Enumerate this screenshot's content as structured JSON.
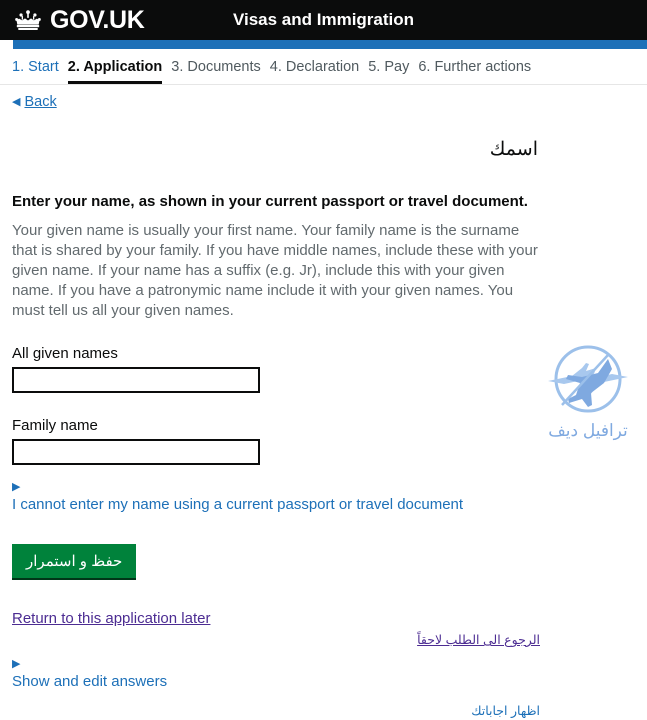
{
  "header": {
    "crown_icon": "crown-icon",
    "brand": "GOV.UK",
    "service_name": "Visas and Immigration"
  },
  "step_nav": {
    "steps": [
      {
        "label": "1. Start",
        "state": "link"
      },
      {
        "label": "2. Application",
        "state": "current"
      },
      {
        "label": "3. Documents",
        "state": "inactive"
      },
      {
        "label": "4. Declaration",
        "state": "inactive"
      },
      {
        "label": "5. Pay",
        "state": "inactive"
      },
      {
        "label": "6. Further actions",
        "state": "inactive"
      }
    ]
  },
  "back": {
    "arrow_icon": "back-arrow-icon",
    "label": "Back"
  },
  "main": {
    "arabic_heading": "اسمك",
    "lede": "Enter your name, as shown in your current passport or travel document.",
    "hint": "Your given name is usually your first name. Your family name is the surname that is shared by your family. If you have middle names, include these with your given name. If your name has a suffix (e.g. Jr), include this with your given name. If you have a patronymic name include it with your given names. You must tell us all your given names.",
    "fields": [
      {
        "label": "All given names",
        "value": "",
        "placeholder": ""
      },
      {
        "label": "Family name",
        "value": "",
        "placeholder": ""
      }
    ],
    "disclosure": {
      "arrow_icon": "disclosure-arrow-icon",
      "label": "I cannot enter my name using a current passport or travel document"
    },
    "save_button": "حفظ و استمرار",
    "return_link": "Return to this application later",
    "return_link_arabic": "الرجوع الى الطلب لاحقاً",
    "answers_disclosure": {
      "arrow_icon": "disclosure-arrow-icon",
      "label": "Show and edit answers"
    },
    "answers_arabic": "اظهار اجاباتك"
  },
  "watermark": {
    "logo_icon": "airplane-circle-logo-icon",
    "text": "ترافيل ديف"
  },
  "colors": {
    "header_black": "#0b0c0c",
    "accent_blue": "#1d70b8",
    "link_visited": "#4c2c92",
    "button_green": "#00823b",
    "muted_grey": "#626a6e",
    "step_inactive": "#505a5f",
    "watermark_blue": "#7fa9e0"
  }
}
